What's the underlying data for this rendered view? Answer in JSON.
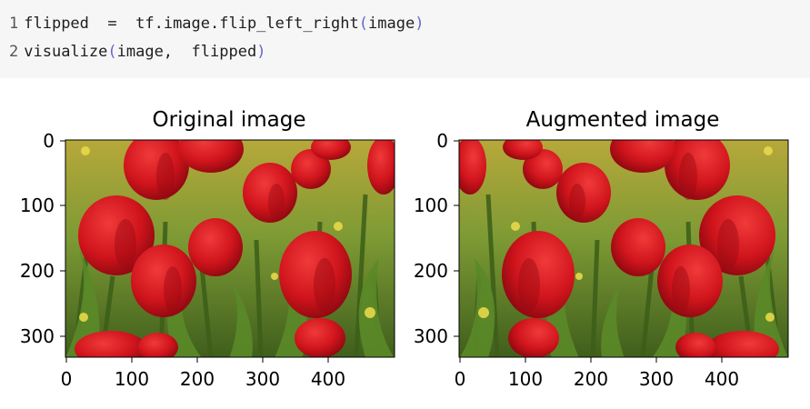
{
  "code": {
    "line1": {
      "num": "1",
      "lhs": "flipped",
      "eq": "=",
      "call": "tf.image.flip_left_right",
      "open": "(",
      "arg": "image",
      "close": ")"
    },
    "line2": {
      "num": "2",
      "call": "visualize",
      "open": "(",
      "arg1": "image,",
      "arg2": "flipped",
      "close": ")"
    }
  },
  "figure": {
    "left": {
      "title": "Original image",
      "image": "photo of red tulips with green leaves",
      "yticks": [
        "0",
        "100",
        "200",
        "300"
      ],
      "xticks": [
        "0",
        "100",
        "200",
        "300",
        "400"
      ]
    },
    "right": {
      "title": "Augmented image",
      "image": "horizontally flipped photo of red tulips",
      "yticks": [
        "0",
        "100",
        "200",
        "300"
      ],
      "xticks": [
        "0",
        "100",
        "200",
        "300",
        "400"
      ]
    }
  },
  "colors": {
    "tulip": "#d31620",
    "tulip_dark": "#8d0a12",
    "leaf": "#4e7a24",
    "leaf_dark": "#2f4a15",
    "bg": "#8fa33a"
  }
}
